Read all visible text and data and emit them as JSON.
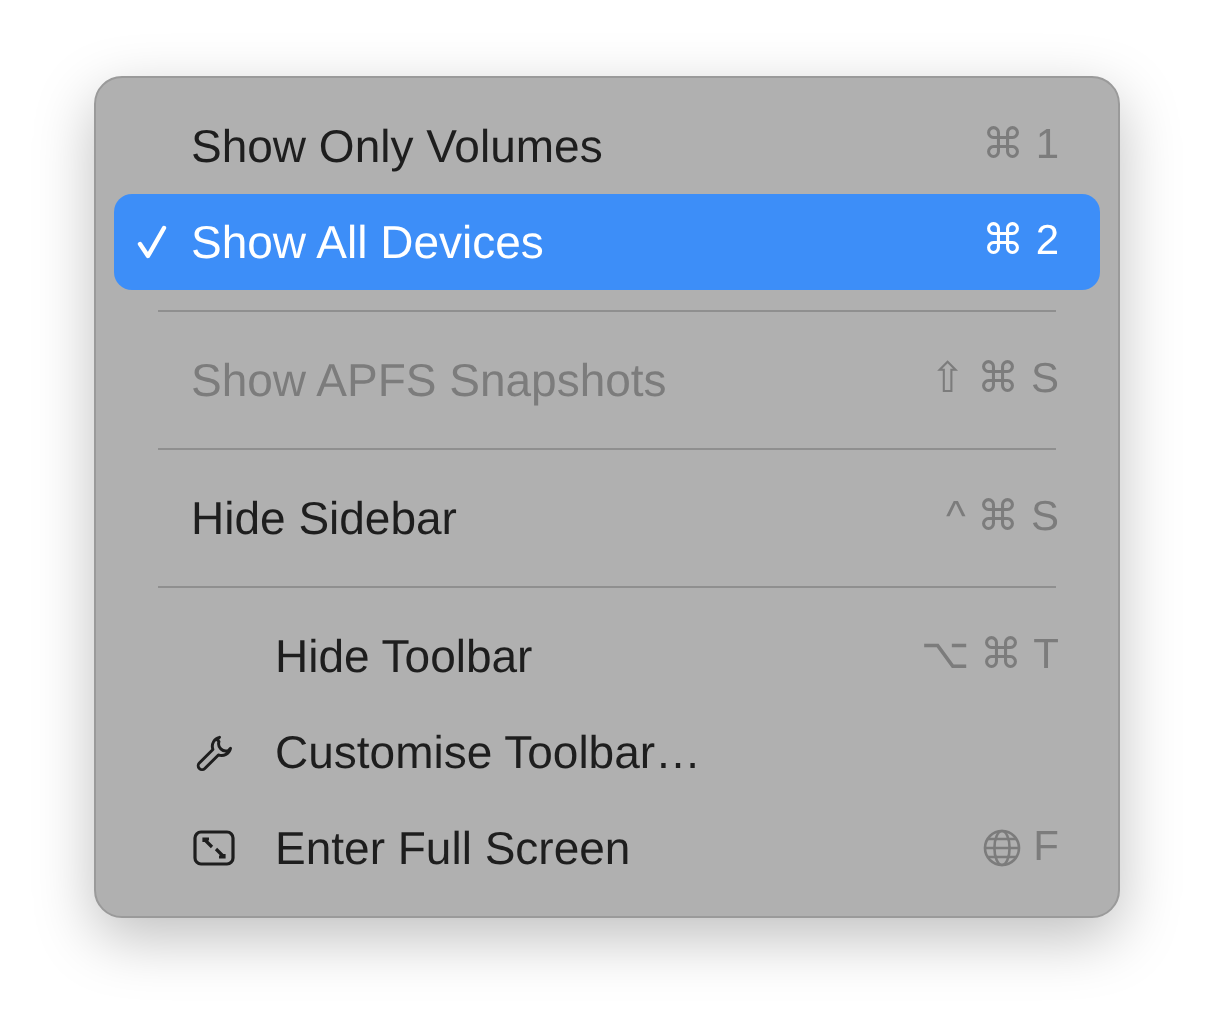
{
  "sections": [
    {
      "items": [
        {
          "kind": "text",
          "label": "Show Only Volumes",
          "shortcut": "⌘ 1",
          "checked": false,
          "selected": false,
          "disabled": false
        },
        {
          "kind": "text",
          "label": "Show All Devices",
          "shortcut": "⌘ 2",
          "checked": true,
          "selected": true,
          "disabled": false
        }
      ]
    },
    {
      "items": [
        {
          "kind": "text",
          "label": "Show APFS Snapshots",
          "shortcut": "⇧ ⌘ S",
          "checked": false,
          "selected": false,
          "disabled": true
        }
      ]
    },
    {
      "items": [
        {
          "kind": "text",
          "label": "Hide Sidebar",
          "shortcut": "^ ⌘ S",
          "checked": false,
          "selected": false,
          "disabled": false
        }
      ]
    },
    {
      "items": [
        {
          "kind": "text",
          "label": "Hide Toolbar",
          "shortcut": "⌥ ⌘ T",
          "checked": false,
          "selected": false,
          "disabled": false
        },
        {
          "kind": "wrench",
          "label": "Customise Toolbar…",
          "checked": false,
          "selected": false,
          "disabled": false
        },
        {
          "kind": "fullscreen",
          "label": "Enter Full Screen",
          "shortcut": "F",
          "checked": false,
          "selected": false,
          "disabled": false
        }
      ]
    }
  ]
}
